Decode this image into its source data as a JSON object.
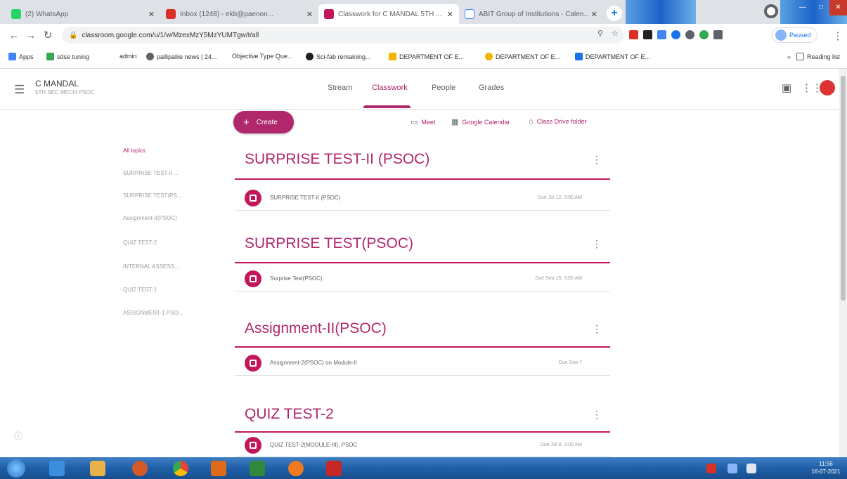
{
  "browser": {
    "tabs": [
      {
        "label": "(2) WhatsApp",
        "color": "#25d366",
        "active": false
      },
      {
        "label": "Inbox (1248) - ekb@paenon...",
        "color": "#d93025",
        "active": false
      },
      {
        "label": "Classwork for C MANDAL 5TH ...",
        "color": "#c2185b",
        "active": true
      },
      {
        "label": "ABIT Group of Institutions - Calen...",
        "color": "#4285f4",
        "active": false
      }
    ],
    "new_tab": "+",
    "url": "classroom.google.com/u/1/w/MzexMzY5MzYUMTgw/t/all",
    "profile_label": "Paused"
  },
  "bookmarks": {
    "items": [
      "Apps",
      "sdse tuning",
      "admin",
      "pallipaliie news | 24...",
      "Objective Type Que...",
      "Sci-fab remaining...",
      "DEPARTMENT OF E...",
      "DEPARTMENT OF E...",
      "DEPARTMENT OF E..."
    ],
    "reading_list": "Reading list"
  },
  "classroom": {
    "class_name": "C MANDAL",
    "class_sub": "5TH SEC MECH PSOC",
    "nav": [
      "Stream",
      "Classwork",
      "People",
      "Grades"
    ]
  },
  "toolbar": {
    "create_label": "Create",
    "meet_label": "Meet",
    "calendar_label": "Google Calendar",
    "drive_label": "Class Drive folder"
  },
  "topics": [
    "All topics",
    "SURPRISE TEST-II ...",
    "SURPRISE TEST(PS...",
    "Assignment-II(PSOC)",
    "QUIZ TEST-2",
    "INTERNAL ASSESS...",
    "QUIZ TEST-1",
    "ASSIGNMENT-1 PSO..."
  ],
  "sections": [
    {
      "title": "SURPRISE TEST-II (PSOC)",
      "item": "SURPRISE TEST-II (PSOC)",
      "date": "Due Jul 12, 3:00 AM"
    },
    {
      "title": "SURPRISE TEST(PSOC)",
      "item": "Surprise Test(PSOC)",
      "date": "Due Sep 15, 3:00 AM"
    },
    {
      "title": "Assignment-II(PSOC)",
      "item": "Assignment-2(PSOC) on Module-II",
      "date": "Due Sep 7"
    },
    {
      "title": "QUIZ TEST-2",
      "item": "QUIZ TEST-2(MODULE-III), PSOC",
      "date": "Due Jul 8, 3:00 AM"
    }
  ],
  "taskbar": {
    "time": "11:56",
    "date": "16-07-2021"
  },
  "colors": {
    "accent": "#b0276b",
    "taskbar": "#1f5fa8"
  }
}
